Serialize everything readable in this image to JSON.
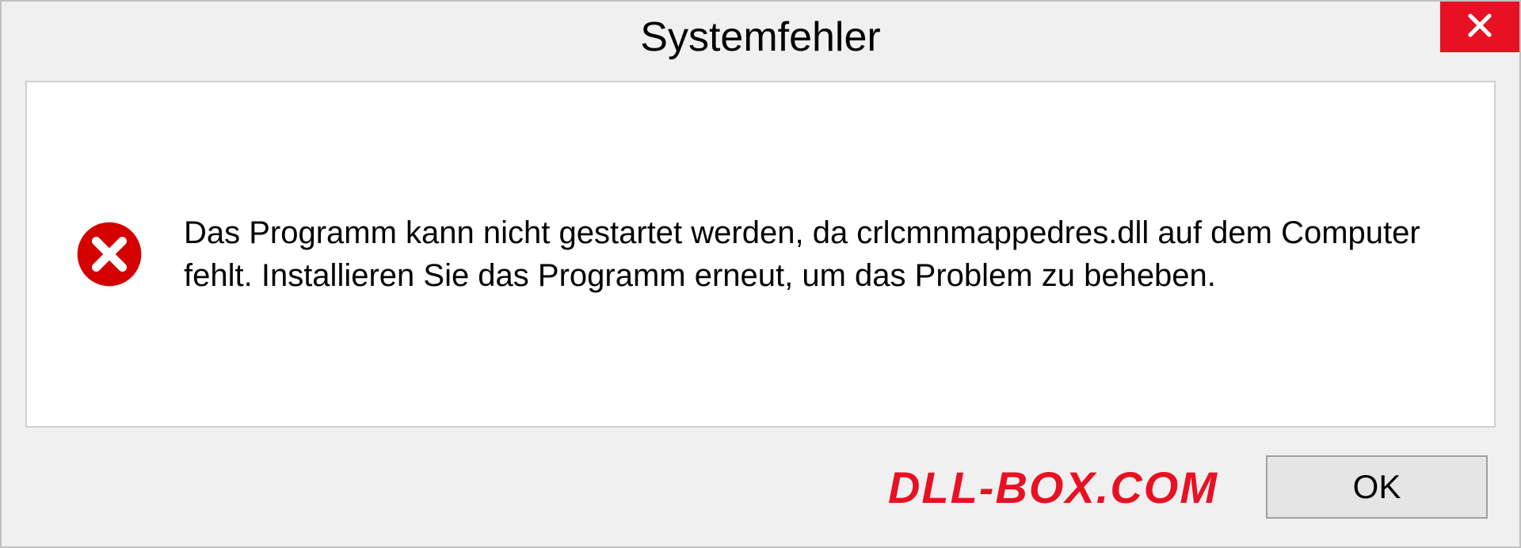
{
  "dialog": {
    "title": "Systemfehler",
    "message": "Das Programm kann nicht gestartet werden, da crlcmnmappedres.dll auf dem Computer fehlt. Installieren Sie das Programm erneut, um das Problem zu beheben.",
    "ok_label": "OK",
    "watermark": "DLL-BOX.COM"
  },
  "icons": {
    "close": "close-icon",
    "error": "error-icon"
  },
  "colors": {
    "close_bg": "#e81123",
    "error_fill": "#d40000",
    "watermark": "#e81123"
  }
}
